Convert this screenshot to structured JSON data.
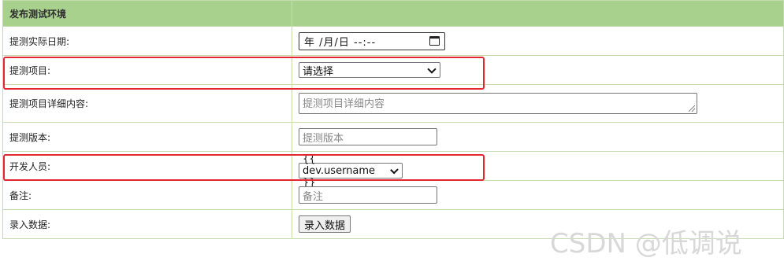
{
  "header": {
    "title": "发布测试环境"
  },
  "rows": {
    "date": {
      "label": "提测实际日期:",
      "value": "年 /月/日 --:--"
    },
    "project": {
      "label": "提测项目:",
      "selected": "请选择"
    },
    "detail": {
      "label": "提测项目详细内容:",
      "placeholder": "提测项目详细内容"
    },
    "version": {
      "label": "提测版本:",
      "placeholder": "提测版本"
    },
    "developer": {
      "label": "开发人员:",
      "selected": "{{ dev.username }}"
    },
    "remark": {
      "label": "备注:",
      "placeholder": "备注"
    },
    "submit": {
      "label": "录入数据:",
      "button": "录入数据"
    }
  },
  "watermark": "CSDN @低调说",
  "colors": {
    "header_bg": "#a9d18e",
    "border": "#c5dcb0",
    "highlight": "#e3262f"
  }
}
